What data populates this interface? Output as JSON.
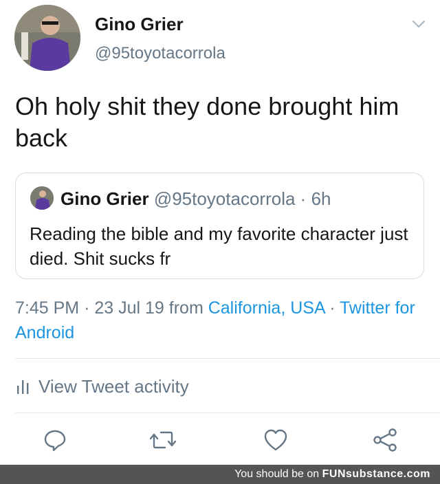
{
  "author": {
    "name": "Gino Grier",
    "handle": "@95toyotacorrola"
  },
  "tweet": {
    "text": "Oh holy shit they done brought him back"
  },
  "quoted_tweet": {
    "name": "Gino Grier",
    "handle": "@95toyotacorrola",
    "separator": "·",
    "age": "6h",
    "text": "Reading the bible and my favorite character just died. Shit sucks fr"
  },
  "meta": {
    "time": "7:45 PM",
    "sep1": "·",
    "date": "23 Jul 19",
    "from_label": "from",
    "location": "California, USA",
    "sep2": "·",
    "client": "Twitter for Android"
  },
  "activity": {
    "label": "View Tweet activity"
  },
  "actions": {
    "icons": [
      "reply-icon",
      "retweet-icon",
      "like-icon",
      "share-icon"
    ]
  },
  "watermark": {
    "prefix": "You should be on",
    "brand_a": "FUN",
    "brand_b": "substance",
    "suffix": ".com"
  },
  "colors": {
    "link": "#1b95e0",
    "secondary_text": "#657786",
    "icon": "#657786",
    "banner_bg": "#545454"
  }
}
